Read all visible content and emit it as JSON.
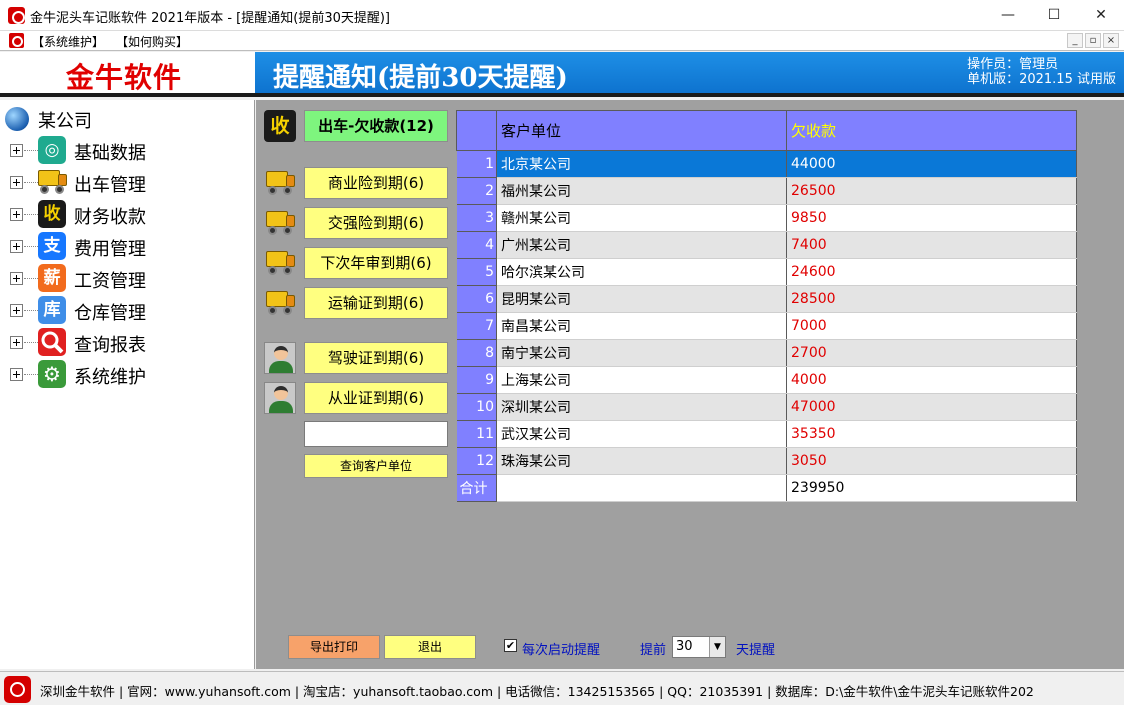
{
  "window": {
    "title": "金牛泥头车记账软件 2021年版本 - [提醒通知(提前30天提醒)]",
    "minimize": "—",
    "maximize": "☐",
    "close": "✕"
  },
  "menu": {
    "items": [
      "【系统维护】",
      "【如何购买】"
    ],
    "mdi_controls": [
      "_",
      "▫",
      "×"
    ]
  },
  "logo": {
    "text": "金牛软件",
    "color": "#e00000"
  },
  "header": {
    "title": "提醒通知(提前30天提醒)",
    "operator": "操作员：管理员",
    "version": "单机版：2021.15 试用版"
  },
  "sidebar": {
    "root": "某公司",
    "items": [
      {
        "label": "基础数据",
        "icon": "database-icon",
        "glyph": "◎",
        "color": "#1faa8f"
      },
      {
        "label": "出车管理",
        "icon": "truck-icon",
        "glyph": "",
        "color": ""
      },
      {
        "label": "财务收款",
        "icon": "receive-money-icon",
        "glyph": "收",
        "color": "#1a1a1a"
      },
      {
        "label": "费用管理",
        "icon": "alipay-icon",
        "glyph": "支",
        "color": "#1677ff"
      },
      {
        "label": "工资管理",
        "icon": "salary-icon",
        "glyph": "薪",
        "color": "#f26b1d"
      },
      {
        "label": "仓库管理",
        "icon": "warehouse-icon",
        "glyph": "库",
        "color": "#3f8ee8"
      },
      {
        "label": "查询报表",
        "icon": "search-report-icon",
        "glyph": "🔍",
        "color": "#e02020"
      },
      {
        "label": "系统维护",
        "icon": "gear-icon",
        "glyph": "⚙",
        "color": "#3a9a3a"
      }
    ]
  },
  "reminders": {
    "receivable_icon_glyph": "收",
    "receivable_button": "出车-欠收款(12)",
    "truck_buttons": [
      "商业险到期(6)",
      "交强险到期(6)",
      "下次年审到期(6)",
      "运输证到期(6)"
    ],
    "person_buttons": [
      "驾驶证到期(6)",
      "从业证到期(6)"
    ],
    "search_value": "",
    "search_button": "查询客户单位"
  },
  "table": {
    "headers": [
      "",
      "客户单位",
      "欠收款"
    ],
    "rows": [
      {
        "no": "1",
        "name": "北京某公司",
        "amount": "44000"
      },
      {
        "no": "2",
        "name": "福州某公司",
        "amount": "26500"
      },
      {
        "no": "3",
        "name": "赣州某公司",
        "amount": "9850"
      },
      {
        "no": "4",
        "name": "广州某公司",
        "amount": "7400"
      },
      {
        "no": "5",
        "name": "哈尔滨某公司",
        "amount": "24600"
      },
      {
        "no": "6",
        "name": "昆明某公司",
        "amount": "28500"
      },
      {
        "no": "7",
        "name": "南昌某公司",
        "amount": "7000"
      },
      {
        "no": "8",
        "name": "南宁某公司",
        "amount": "2700"
      },
      {
        "no": "9",
        "name": "上海某公司",
        "amount": "4000"
      },
      {
        "no": "10",
        "name": "深圳某公司",
        "amount": "47000"
      },
      {
        "no": "11",
        "name": "武汉某公司",
        "amount": "35350"
      },
      {
        "no": "12",
        "name": "珠海某公司",
        "amount": "3050"
      }
    ],
    "selected_row": 1,
    "total_label": "合计",
    "total_amount": "239950"
  },
  "footer_controls": {
    "export_button": "导出打印",
    "exit_button": "退出",
    "checkbox_checked": true,
    "checkbox_mark": "✔",
    "checkbox_label": "每次启动提醒",
    "advance_label": "提前",
    "days_value": "30",
    "days_suffix": "天提醒"
  },
  "statusbar": {
    "text": "深圳金牛软件 | 官网：www.yuhansoft.com | 淘宝店：yuhansoft.taobao.com | 电话微信：13425153565 | QQ：21035391 | 数据库：D:\\金牛软件\\金牛泥头车记账软件202"
  }
}
